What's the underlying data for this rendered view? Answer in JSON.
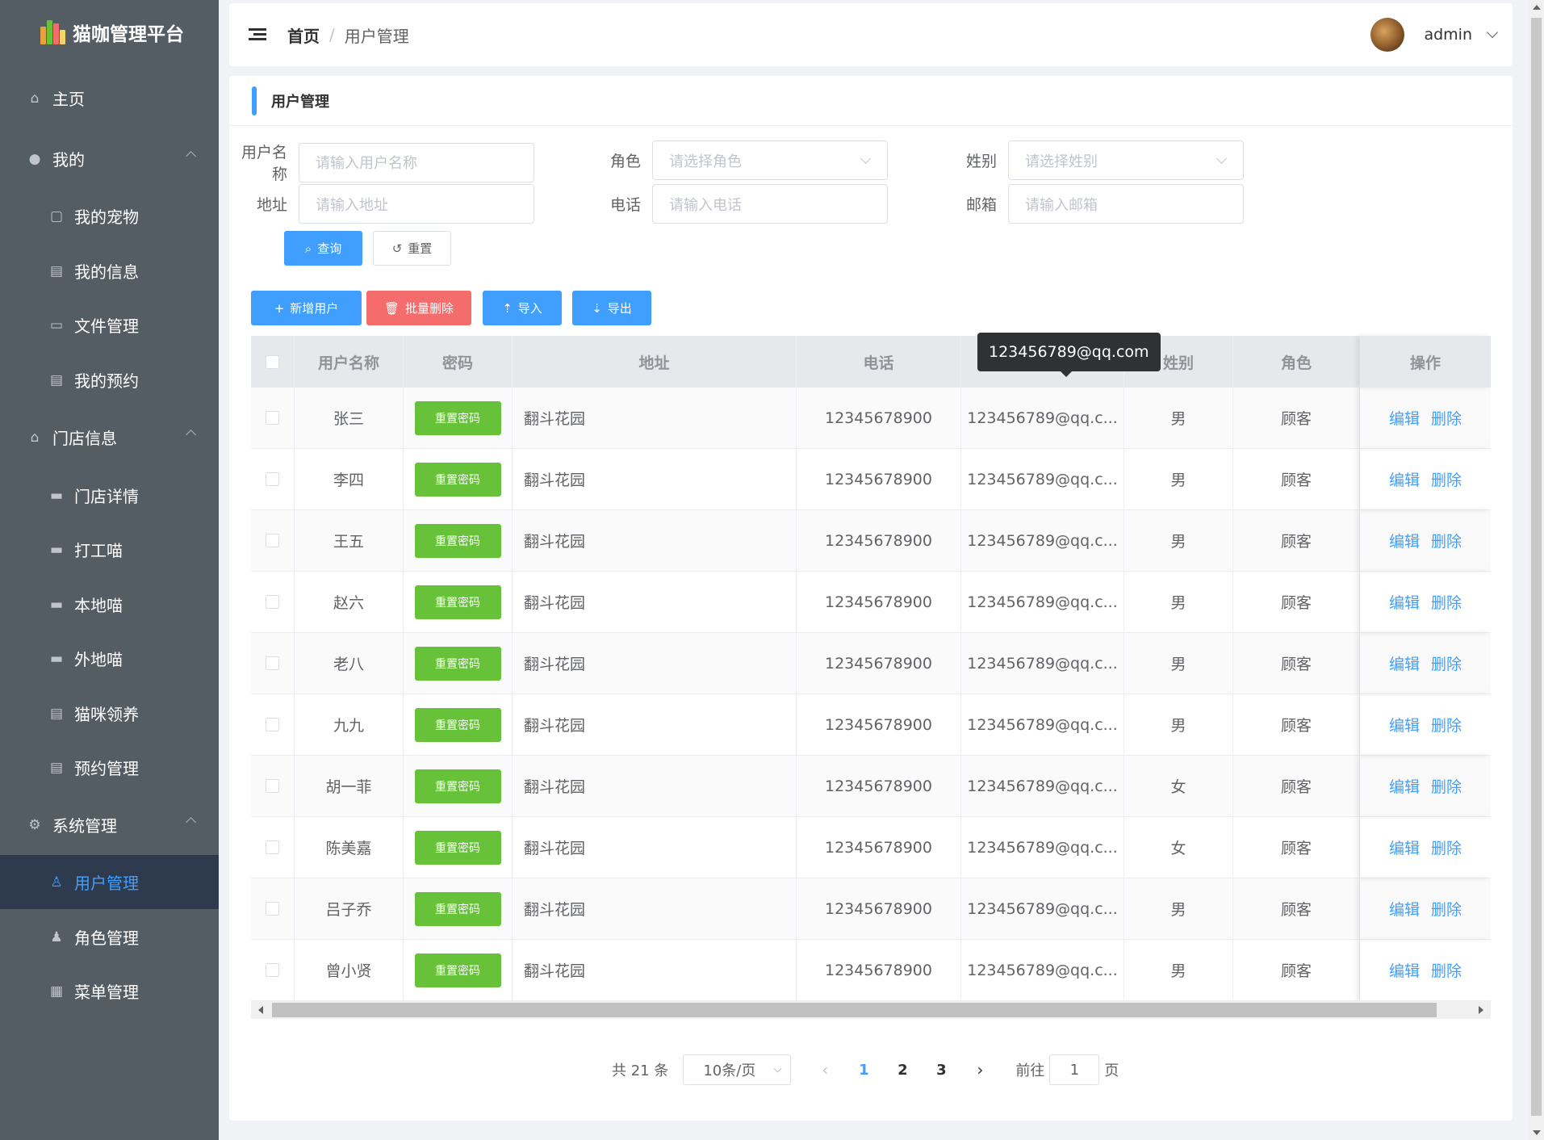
{
  "sidebar": {
    "logo_text": "猫咖管理平台",
    "items": [
      {
        "label": "主页",
        "icon": "home-icon"
      },
      {
        "label": "我的",
        "icon": "user-icon"
      },
      {
        "label": "我的宠物",
        "icon": "pet-icon"
      },
      {
        "label": "我的信息",
        "icon": "document-icon"
      },
      {
        "label": "文件管理",
        "icon": "folder-icon"
      },
      {
        "label": "我的预约",
        "icon": "document-icon"
      },
      {
        "label": "门店信息",
        "icon": "home-icon"
      },
      {
        "label": "门店详情",
        "icon": "monitor-icon"
      },
      {
        "label": "打工喵",
        "icon": "monitor-icon"
      },
      {
        "label": "本地喵",
        "icon": "monitor-icon"
      },
      {
        "label": "外地喵",
        "icon": "monitor-icon"
      },
      {
        "label": "猫咪领养",
        "icon": "document-icon"
      },
      {
        "label": "预约管理",
        "icon": "document-icon"
      },
      {
        "label": "系统管理",
        "icon": "gear-icon"
      },
      {
        "label": "用户管理",
        "icon": "user-icon"
      },
      {
        "label": "角色管理",
        "icon": "user-icon"
      },
      {
        "label": "菜单管理",
        "icon": "grid-icon"
      }
    ]
  },
  "header": {
    "breadcrumb_home": "首页",
    "breadcrumb_sep": "/",
    "breadcrumb_current": "用户管理",
    "username": "admin"
  },
  "page": {
    "title": "用户管理"
  },
  "filters": {
    "username": {
      "label": "用户名称",
      "placeholder": "请输入用户名称"
    },
    "role": {
      "label": "角色",
      "placeholder": "请选择角色"
    },
    "gender": {
      "label": "姓别",
      "placeholder": "请选择姓别"
    },
    "address": {
      "label": "地址",
      "placeholder": "请输入地址"
    },
    "phone": {
      "label": "电话",
      "placeholder": "请输入电话"
    },
    "email": {
      "label": "邮箱",
      "placeholder": "请输入邮箱"
    },
    "search_label": "查询",
    "reset_label": "重置"
  },
  "toolbar": {
    "add_label": "新增用户",
    "batch_delete_label": "批量删除",
    "import_label": "导入",
    "export_label": "导出"
  },
  "table": {
    "columns": [
      "用户名称",
      "密码",
      "地址",
      "电话",
      "邮箱",
      "姓别",
      "角色",
      "操作"
    ],
    "reset_password_label": "重置密码",
    "edit_label": "编辑",
    "delete_label": "删除",
    "tooltip": "123456789@qq.com",
    "rows": [
      {
        "name": "张三",
        "address": "翻斗花园",
        "phone": "12345678900",
        "email": "123456789@qq.c...",
        "gender": "男",
        "role": "顾客"
      },
      {
        "name": "李四",
        "address": "翻斗花园",
        "phone": "12345678900",
        "email": "123456789@qq.c...",
        "gender": "男",
        "role": "顾客"
      },
      {
        "name": "王五",
        "address": "翻斗花园",
        "phone": "12345678900",
        "email": "123456789@qq.c...",
        "gender": "男",
        "role": "顾客"
      },
      {
        "name": "赵六",
        "address": "翻斗花园",
        "phone": "12345678900",
        "email": "123456789@qq.c...",
        "gender": "男",
        "role": "顾客"
      },
      {
        "name": "老八",
        "address": "翻斗花园",
        "phone": "12345678900",
        "email": "123456789@qq.c...",
        "gender": "男",
        "role": "顾客"
      },
      {
        "name": "九九",
        "address": "翻斗花园",
        "phone": "12345678900",
        "email": "123456789@qq.c...",
        "gender": "男",
        "role": "顾客"
      },
      {
        "name": "胡一菲",
        "address": "翻斗花园",
        "phone": "12345678900",
        "email": "123456789@qq.c...",
        "gender": "女",
        "role": "顾客"
      },
      {
        "name": "陈美嘉",
        "address": "翻斗花园",
        "phone": "12345678900",
        "email": "123456789@qq.c...",
        "gender": "女",
        "role": "顾客"
      },
      {
        "name": "吕子乔",
        "address": "翻斗花园",
        "phone": "12345678900",
        "email": "123456789@qq.c...",
        "gender": "男",
        "role": "顾客"
      },
      {
        "name": "曾小贤",
        "address": "翻斗花园",
        "phone": "12345678900",
        "email": "123456789@qq.c...",
        "gender": "男",
        "role": "顾客"
      }
    ]
  },
  "pagination": {
    "total_text": "共 21 条",
    "page_size": "10条/页",
    "pages": [
      "1",
      "2",
      "3"
    ],
    "current_page": "1",
    "goto_prefix": "前往",
    "goto_value": "1",
    "goto_suffix": "页"
  },
  "colors": {
    "sidebar_bg": "#545c64",
    "active_bg": "#2e3b4e",
    "primary": "#409eff",
    "success": "#67c23a",
    "danger": "#f56c6c"
  }
}
